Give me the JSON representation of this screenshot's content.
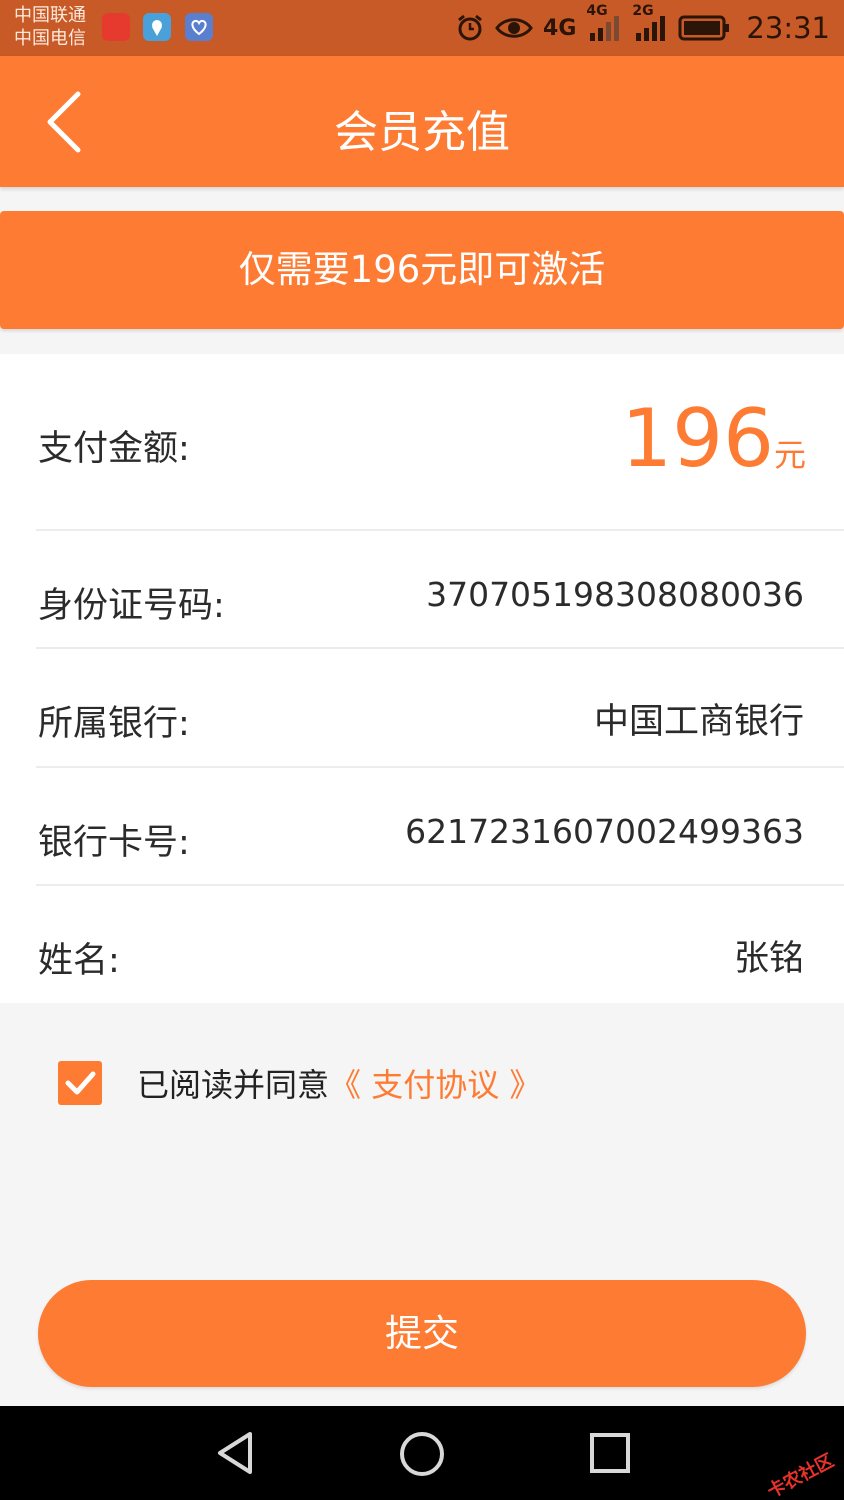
{
  "status_bar": {
    "carriers": [
      "中国联通",
      "中国电信"
    ],
    "net_4g_top": "4G",
    "net_4g_small": "4G",
    "net_2g": "2G",
    "time": "23:31"
  },
  "header": {
    "title": "会员充值"
  },
  "banner": {
    "text": "仅需要196元即可激活"
  },
  "payment": {
    "amount_label": "支付金额:",
    "amount_value": "196",
    "amount_unit": "元",
    "id_label": "身份证号码:",
    "id_value": "370705198308080036",
    "bank_label": "所属银行:",
    "bank_value": "中国工商银行",
    "card_label": "银行卡号:",
    "card_value": "6217231607002499363",
    "name_label": "姓名:",
    "name_value": "张铭"
  },
  "agreement": {
    "checked": true,
    "text": "已阅读并同意",
    "link": "《 支付协议 》"
  },
  "actions": {
    "submit_label": "提交"
  },
  "nav_bar": {
    "watermark": "卡农社区"
  },
  "colors": {
    "accent": "#fe7b33",
    "status_bar": "#c75a26",
    "background": "#f5f5f5"
  },
  "icons": {
    "back": "chevron-left-icon",
    "checkbox": "checkmark-icon",
    "nav_back": "triangle-back-icon",
    "nav_home": "circle-home-icon",
    "nav_recent": "square-recent-icon"
  }
}
